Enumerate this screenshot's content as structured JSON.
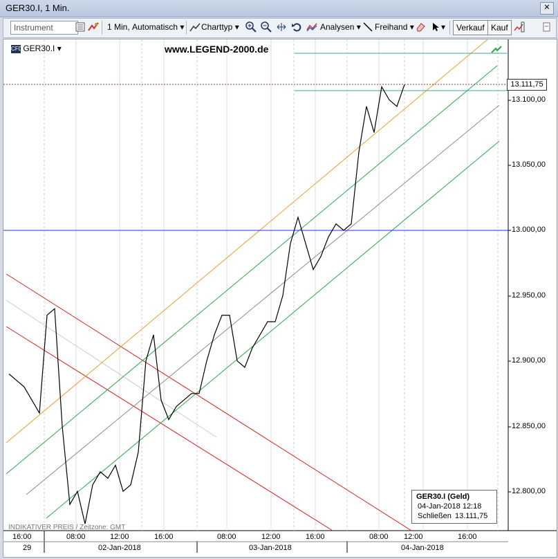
{
  "window": {
    "title": "GER30.I, 1 Min."
  },
  "toolbar": {
    "instrument_placeholder": "Instrument",
    "interval": "1 Min,",
    "scale": "Automatisch",
    "chart_type": "Charttyp",
    "analyses": "Analysen",
    "freehand": "Freihand",
    "sell": "Verkauf",
    "buy": "Kauf"
  },
  "chart": {
    "symbol": "GER30.I",
    "watermark": "www.LEGEND-2000.de",
    "footer_note": "INDIKATIVER PREIS / Zeitzone: GMT",
    "last_price": "13.111,75",
    "y_axis_labels": [
      "13.100,00",
      "13.050,00",
      "13.000,00",
      "12.950,00",
      "12.900,00",
      "12.850,00",
      "12.800,00"
    ],
    "x_axis_times": [
      "16:00",
      "08:00",
      "12:00",
      "16:00",
      "08:00",
      "12:00",
      "16:00",
      "08:00",
      "12:00",
      "16:00"
    ],
    "x_axis_dates": [
      "29",
      "02-Jan-2018",
      "03-Jan-2018",
      "04-Jan-2018"
    ],
    "info": {
      "title": "GER30.I (Geld)",
      "datetime": "04-Jan-2018 12:18",
      "close_label": "Schließen",
      "close_value": "13.111,75"
    }
  },
  "colors": {
    "price_line": "#000000",
    "horizontal_level": "#2a2aff",
    "channel_orange": "#e8a030",
    "channel_green": "#2aa84a",
    "channel_gray": "#8c8c8c",
    "channel_red": "#dd2222",
    "guide_teal": "#3aa9a0"
  },
  "chart_data": {
    "type": "line",
    "title": "",
    "xlabel": "",
    "ylabel": "",
    "ylim": [
      12770,
      13140
    ],
    "series": [
      {
        "values": [
          12890,
          12885,
          12880,
          12870,
          12860,
          12935,
          12940,
          12850,
          12790,
          12800,
          12775,
          12805,
          12815,
          12810,
          12820,
          12800,
          12805,
          12830,
          12900,
          12920,
          12870,
          12855,
          12865,
          12870,
          12875,
          12875,
          12900,
          12920,
          12935,
          12935,
          12900,
          12895,
          12910,
          12920,
          12930,
          12930,
          12950,
          12990,
          13010,
          12990,
          12970,
          12980,
          12995,
          13005,
          13000,
          13005,
          13060,
          13095,
          13075,
          13110,
          13100,
          13095,
          13111.75
        ]
      }
    ]
  }
}
